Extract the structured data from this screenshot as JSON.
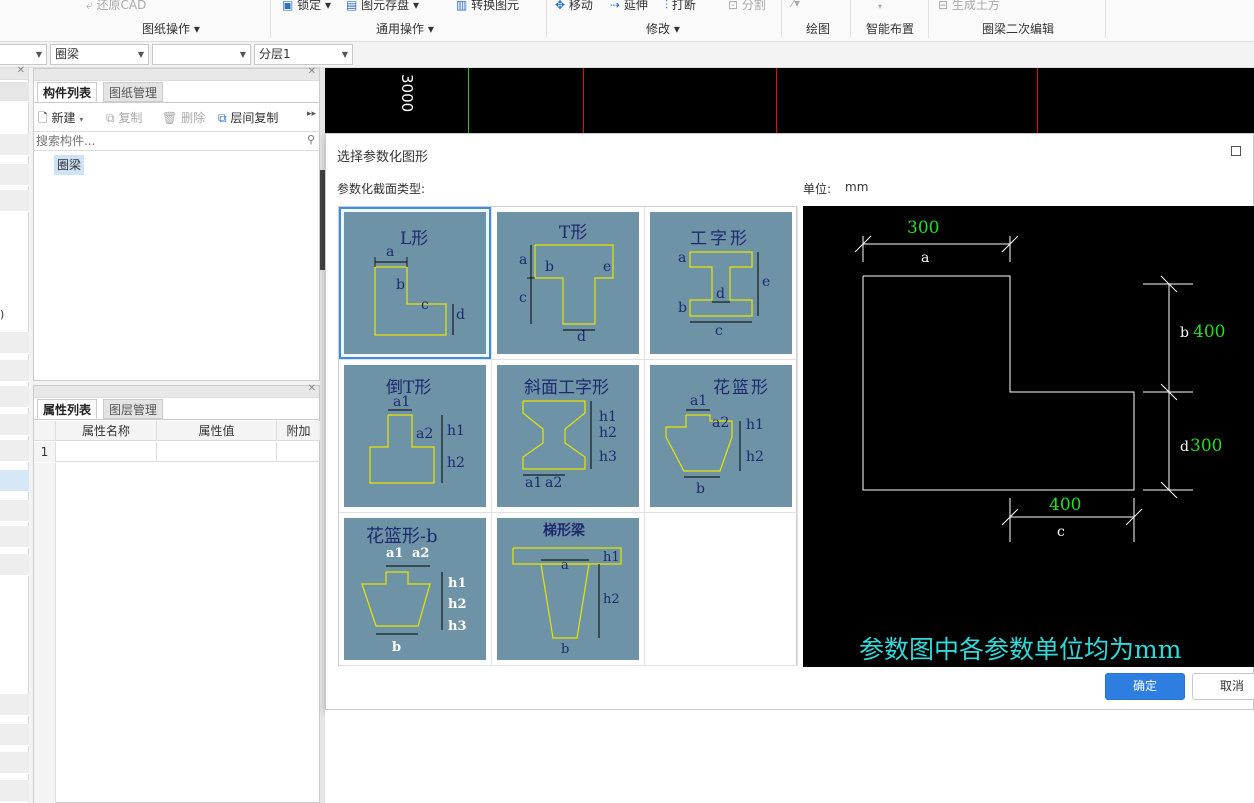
{
  "ribbon": {
    "tools": {
      "restore_cad": "还原CAD",
      "lock": "锁定",
      "save_element": "图元存盘",
      "convert_element": "转换图元",
      "move": "移动",
      "extend": "延伸",
      "break": "打断",
      "split": "分割"
    },
    "groups": {
      "drawing_ops": "图纸操作",
      "common_ops": "通用操作",
      "modify": "修改",
      "draw": "绘图",
      "smart_layout": "智能布置",
      "ring_beam_edit": "圈梁二次编辑"
    }
  },
  "combos": {
    "component_type": "圈梁",
    "component_name": "",
    "layer": "分层1"
  },
  "component_panel": {
    "tabs": [
      "构件列表",
      "图纸管理"
    ],
    "toolbar": {
      "new": "新建",
      "copy": "复制",
      "delete": "删除",
      "floor_copy": "层间复制"
    },
    "search_placeholder": "搜索构件...",
    "tree_item": "圈梁"
  },
  "property_panel": {
    "tabs": [
      "属性列表",
      "图层管理"
    ],
    "columns": [
      "属性名称",
      "属性值",
      "附加"
    ],
    "rows": [
      {
        "index": "1",
        "name": "",
        "value": "",
        "extra": ""
      }
    ]
  },
  "cad": {
    "dimension_text": "3000"
  },
  "left_strip": {
    "fragment": ")"
  },
  "dialog": {
    "title": "选择参数化图形",
    "section_label": "参数化截面类型:",
    "unit_label": "单位:",
    "unit_value": "mm",
    "shapes": [
      {
        "title": "L形",
        "labels": [
          "a",
          "b",
          "c",
          "d"
        ]
      },
      {
        "title": "T形",
        "labels": [
          "a",
          "b",
          "e",
          "c",
          "d"
        ]
      },
      {
        "title": "工字形",
        "labels": [
          "a",
          "e",
          "d",
          "b",
          "c"
        ]
      },
      {
        "title": "倒T形",
        "labels": [
          "a1",
          "a2",
          "h1",
          "h2"
        ]
      },
      {
        "title": "斜面工字形",
        "labels": [
          "h1",
          "h2",
          "h3",
          "a1",
          "a2"
        ]
      },
      {
        "title": "花篮形",
        "labels": [
          "a1",
          "a2",
          "h1",
          "h2",
          "b"
        ]
      },
      {
        "title": "花篮形-b",
        "labels": [
          "a1",
          "a2",
          "h1",
          "h2",
          "h3",
          "b"
        ]
      },
      {
        "title": "梯形梁",
        "labels": [
          "a",
          "h1",
          "h2",
          "b"
        ]
      }
    ],
    "preview": {
      "a_value": "300",
      "a_label": "a",
      "b_label": "b",
      "b_value": "400",
      "d_label": "d",
      "d_value": "300",
      "c_value": "400",
      "c_label": "c",
      "note": "参数图中各参数单位均为mm"
    },
    "ok_button": "确定",
    "cancel_button": "取消",
    "maximize_icon": "maximize-icon"
  },
  "colors": {
    "thumb_bg": "#6f93a6",
    "shape_line": "#e6e600",
    "thumb_text": "#1c2a6e",
    "preview_value": "#22dd22",
    "preview_note": "#33d8d8",
    "accent": "#2d7ee0"
  }
}
